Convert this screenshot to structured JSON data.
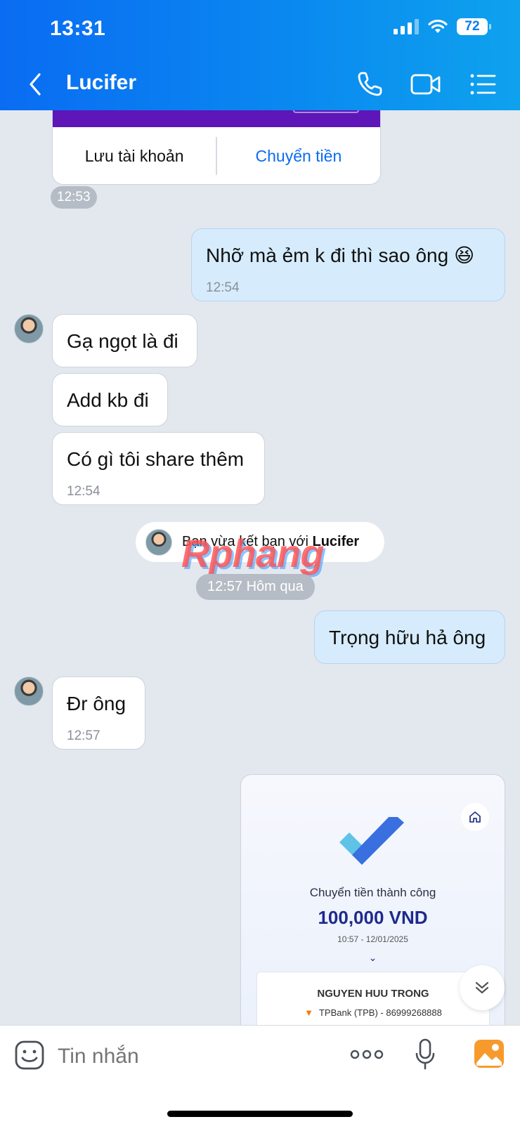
{
  "status_bar": {
    "time": "13:31",
    "battery": "72"
  },
  "header": {
    "title": "Lucifer"
  },
  "messages": {
    "card_save_label": "Lưu tài khoản",
    "card_transfer_label": "Chuyển tiền",
    "card_time": "12:53",
    "out1_text": "Nhỡ mà ẻm k đi thì sao ông 😆",
    "out1_time": "12:54",
    "in1_text": "Gạ ngọt là đi",
    "in2_text": "Add kb đi",
    "in3_text": "Có gì tôi share thêm",
    "in3_time": "12:54",
    "system_prefix": "Bạn vừa kết bạn với ",
    "system_name": "Lucifer",
    "watermark": "Rphang",
    "divider_time": "12:57 Hôm qua",
    "out2_text": "Trọng hữu hả ông",
    "in4_text": "Đr ông",
    "in4_time": "12:57"
  },
  "receipt": {
    "title": "Chuyển tiền thành công",
    "amount": "100,000 VND",
    "datetime": "10:57 - 12/01/2025",
    "name": "NGUYEN HUU TRONG",
    "bank": "TPBank (TPB) - 86999268888"
  },
  "input": {
    "placeholder": "Tin nhắn"
  },
  "colors": {
    "header_start": "#0a6cf2",
    "header_end": "#0ea2ee",
    "outgoing_bubble": "#d6ecfd",
    "accent": "#0a6cf2"
  }
}
